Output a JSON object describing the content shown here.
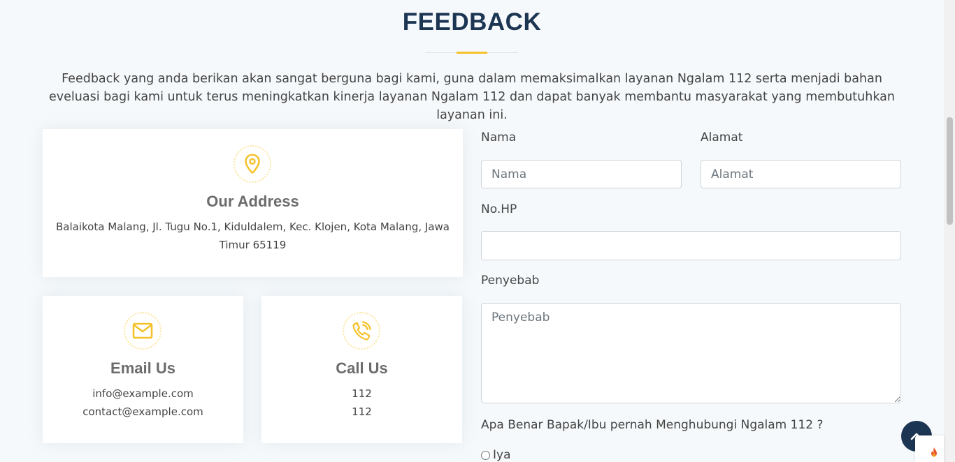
{
  "section": {
    "title": "FEEDBACK",
    "intro": "Feedback yang anda berikan akan sangat berguna bagi kami, guna dalam memaksimalkan layanan Ngalam 112 serta menjadi bahan eveluasi bagi kami untuk terus meningkatkan kinerja layanan Ngalam 112 dan dapat banyak membantu masyarakat yang membutuhkan layanan ini."
  },
  "colors": {
    "accent": "#f5c22c",
    "heading": "#1c3553",
    "card_title": "#6c6c6c",
    "background": "#f6f9fb"
  },
  "cards": {
    "address": {
      "icon": "map-pin-icon",
      "title": "Our Address",
      "text": "Balaikota Malang, Jl. Tugu No.1, Kiduldalem, Kec. Klojen, Kota Malang, Jawa Timur 65119"
    },
    "email": {
      "icon": "envelope-icon",
      "title": "Email Us",
      "line1": "info@example.com",
      "line2": "contact@example.com"
    },
    "call": {
      "icon": "phone-call-icon",
      "title": "Call Us",
      "line1": "112",
      "line2": "112"
    }
  },
  "form": {
    "nama": {
      "label": "Nama",
      "placeholder": "Nama",
      "value": ""
    },
    "alamat": {
      "label": "Alamat",
      "placeholder": "Alamat",
      "value": ""
    },
    "nohp": {
      "label": "No.HP",
      "placeholder": "",
      "value": ""
    },
    "penyebab": {
      "label": "Penyebab",
      "placeholder": "Penyebab",
      "value": ""
    },
    "question": "Apa Benar Bapak/Ibu pernah Menghubungi Ngalam 112 ?",
    "option_yes": "Iya"
  },
  "widgets": {
    "back_to_top_icon": "chevron-up-icon",
    "badge_icon": "flame-icon"
  }
}
